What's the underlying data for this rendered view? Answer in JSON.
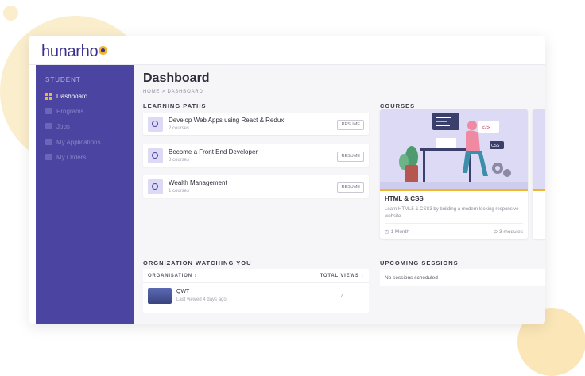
{
  "app": {
    "logo": "hunarho"
  },
  "sidebar": {
    "section": "STUDENT",
    "items": [
      {
        "label": "Dashboard",
        "active": true
      },
      {
        "label": "Programs",
        "active": false
      },
      {
        "label": "Jobs",
        "active": false
      },
      {
        "label": "My Applications",
        "active": false
      },
      {
        "label": "My Orders",
        "active": false
      }
    ]
  },
  "page": {
    "title": "Dashboard",
    "breadcrumb": "HOME > DASHBOARD"
  },
  "learning_paths": {
    "heading": "LEARNING PATHS",
    "button_label": "RESUME",
    "items": [
      {
        "title": "Develop Web Apps using React & Redux",
        "subtitle": "2 courses"
      },
      {
        "title": "Become a Front End Developer",
        "subtitle": "3 courses"
      },
      {
        "title": "Wealth Management",
        "subtitle": "1 courses"
      }
    ]
  },
  "courses": {
    "heading": "COURSES",
    "items": [
      {
        "title": "HTML & CSS",
        "description": "Learn HTML5 & CSS3 by building a modern looking responsive website.",
        "duration": "1 Month",
        "modules": "3 modules"
      }
    ]
  },
  "organizations": {
    "heading": "ORGNIZATION WATCHING YOU",
    "col_org": "ORGANISATION",
    "col_views": "TOTAL VIEWS",
    "rows": [
      {
        "name": "QWT",
        "last_viewed": "Last viewed 4 days ago",
        "views": "7"
      }
    ]
  },
  "sessions": {
    "heading": "UPCOMING SESSIONS",
    "empty": "No sessions scheduled"
  },
  "colors": {
    "sidebar": "#4b44a0",
    "accent": "#f2b431",
    "logo": "#3b2f8f"
  }
}
